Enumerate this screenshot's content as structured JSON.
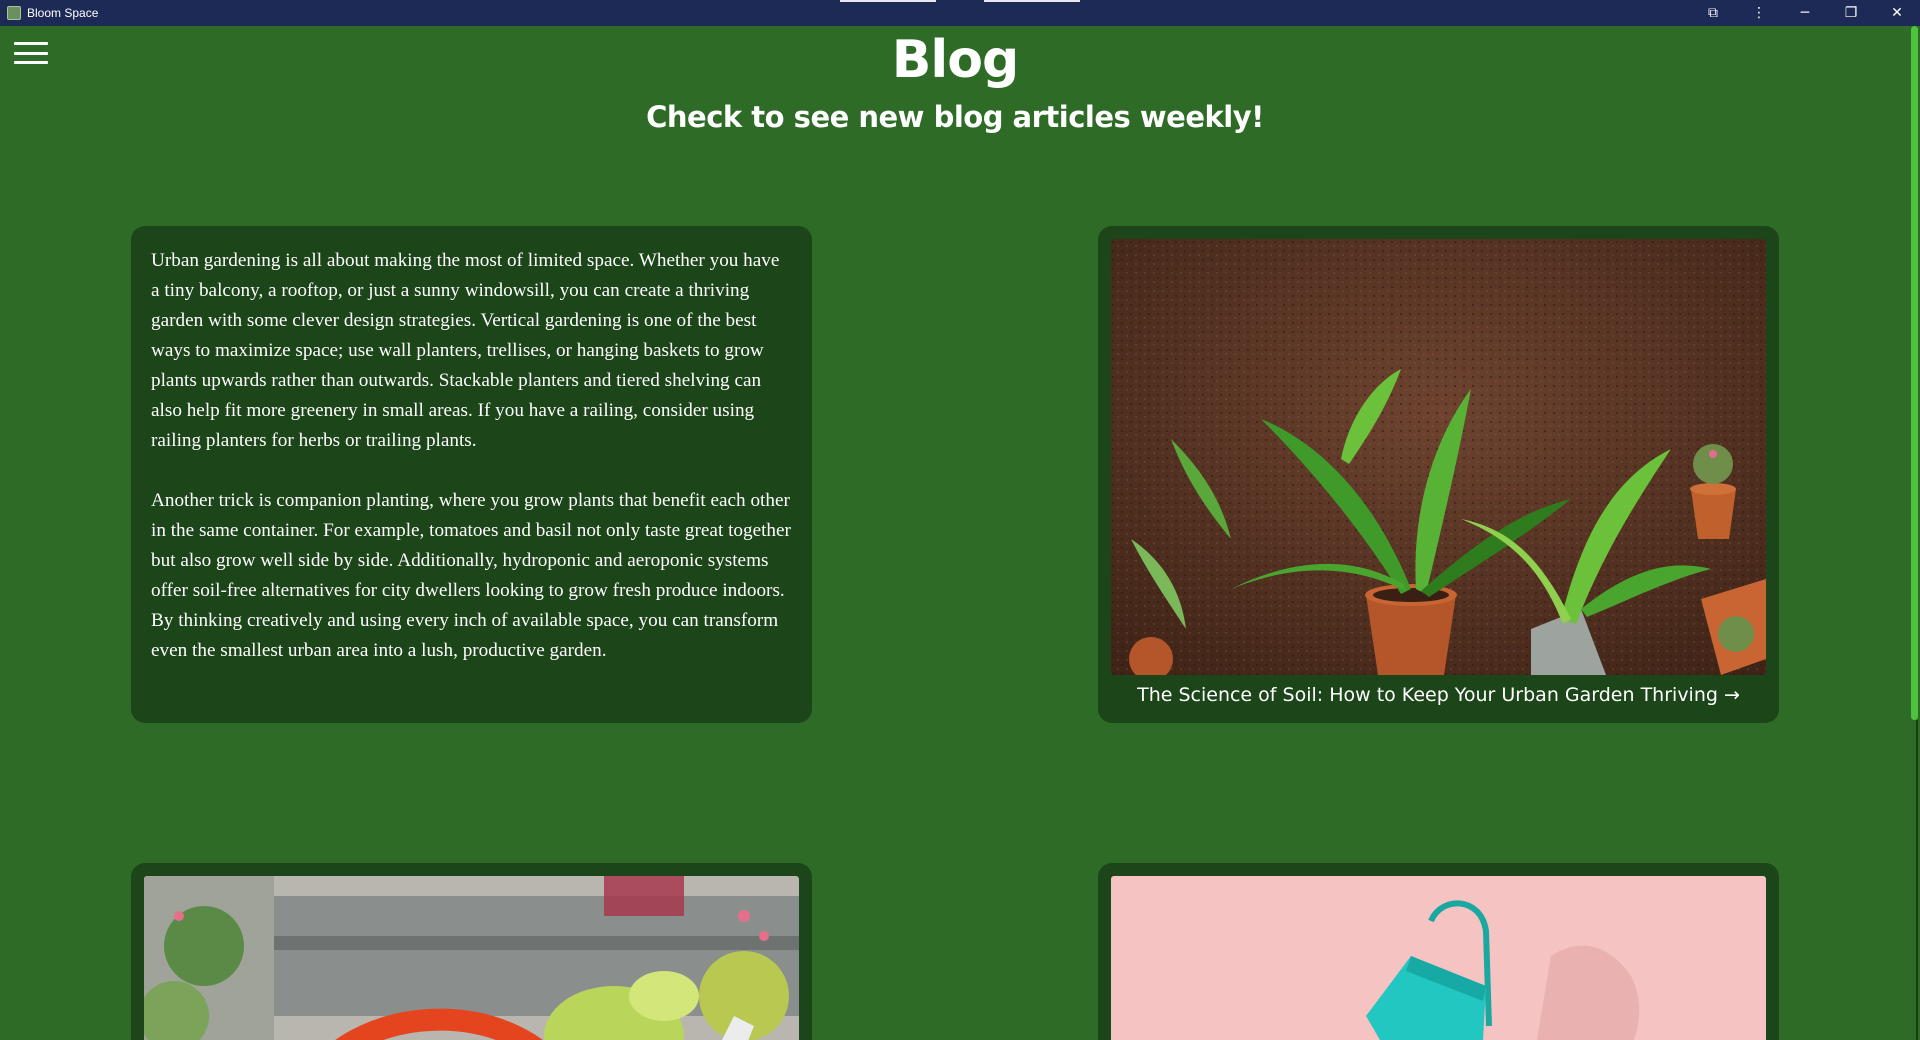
{
  "window": {
    "title": "Bloom Space",
    "controls": {
      "minimize": "─",
      "maximize": "❐",
      "close": "✕",
      "extensions": "⧉",
      "menu": "⋮"
    }
  },
  "header": {
    "title": "Blog",
    "subtitle": "Check to see new blog articles weekly!"
  },
  "articles": {
    "intro": {
      "paragraphs": [
        "Urban gardening is all about making the most of limited space. Whether you have a tiny balcony, a rooftop, or just a sunny windowsill, you can create a thriving garden with some clever design strategies. Vertical gardening is one of the best ways to maximize space; use wall planters, trellises, or hanging baskets to grow plants upwards rather than outwards. Stackable planters and tiered shelving can also help fit more greenery in small areas. If you have a railing, consider using railing planters for herbs or trailing plants.",
        "Another trick is companion planting, where you grow plants that benefit each other in the same container. For example, tomatoes and basil not only taste great together but also grow well side by side. Additionally, hydroponic and aeroponic systems offer soil-free alternatives for city dwellers looking to grow fresh produce indoors. By thinking creatively and using every inch of available space, you can transform even the smallest urban area into a lush, productive garden."
      ]
    },
    "soil": {
      "link": "The Science of Soil: How to Keep Your Urban Garden Thriving →",
      "image": "potted-plants-on-soil"
    },
    "third": {
      "image": "garden-watering-can-succulents"
    },
    "fourth": {
      "image": "teal-watering-can-pink-background"
    }
  },
  "colors": {
    "page_bg": "#2e6b27",
    "card_bg": "#1c4519",
    "titlebar_bg": "#1d2a55",
    "scroll_thumb": "#4ec33e"
  }
}
